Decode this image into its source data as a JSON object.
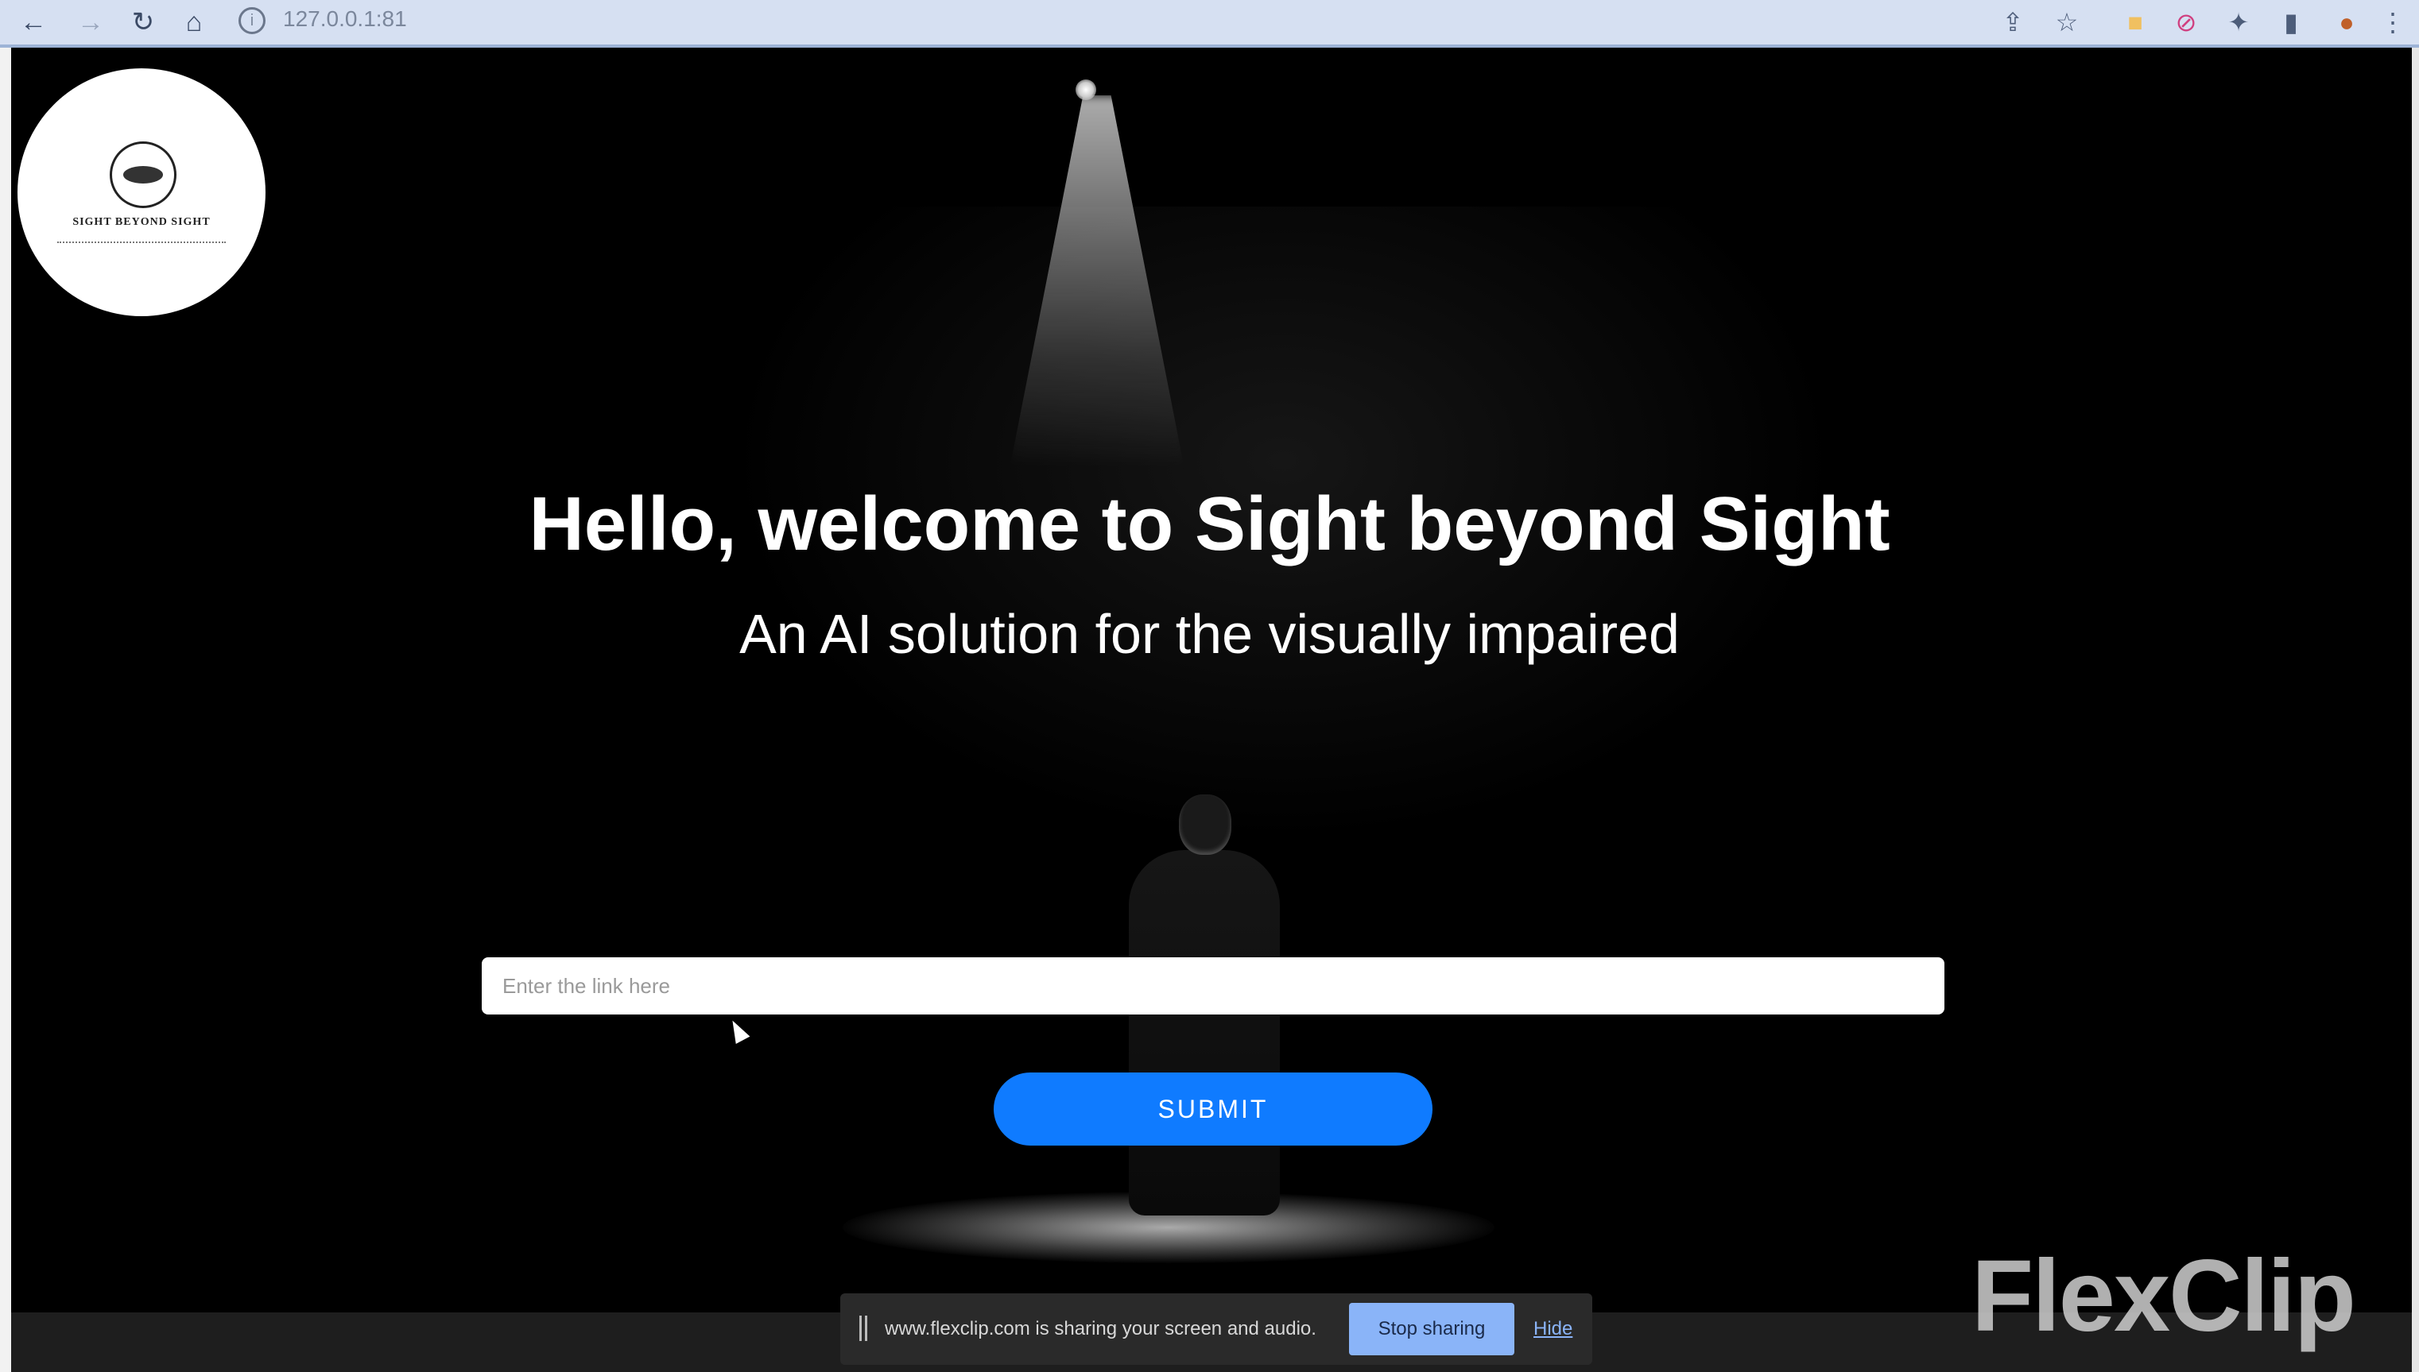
{
  "browser": {
    "url": "127.0.0.1:81",
    "nav": {
      "back": "←",
      "forward": "→",
      "reload": "↻",
      "home": "⌂"
    }
  },
  "logo": {
    "name": "SIGHT BEYOND SIGHT",
    "icon": "eye-icon"
  },
  "hero": {
    "title": "Hello, welcome to Sight beyond Sight",
    "subtitle": "An AI solution for the visually impaired"
  },
  "form": {
    "placeholder": "Enter the link here",
    "submit_label": "SUBMIT"
  },
  "share_bar": {
    "message": "www.flexclip.com is sharing your screen and audio.",
    "stop_label": "Stop sharing",
    "hide_label": "Hide"
  },
  "watermark": {
    "text": "FlexClip"
  },
  "colors": {
    "submit": "#0f7bff",
    "stop_sharing": "#8ab4f8",
    "background": "#000000"
  }
}
